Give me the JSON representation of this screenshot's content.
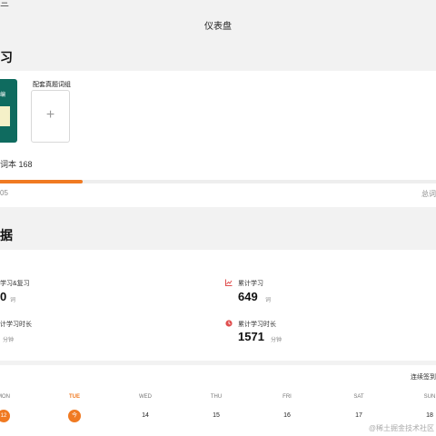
{
  "header": {
    "corner_text": "三",
    "title": "仪表盘"
  },
  "wordbook": {
    "section_title": "习",
    "current_book_text": "编",
    "add_label": "配套真题词组",
    "add_icon": "plus-icon",
    "count_text": "词本 168",
    "progress": 0.19,
    "progress_color": "#f07a22",
    "progress_left_text": "05",
    "progress_right_text": "总词"
  },
  "stats": {
    "section_title": "据",
    "items": [
      {
        "label": "学习&复习",
        "value": "0",
        "unit": "词",
        "icon": ""
      },
      {
        "label": "累计学习",
        "value": "649",
        "unit": "词",
        "icon": "chart-line-icon"
      },
      {
        "label": "计学习时长",
        "value": "",
        "unit": "分钟",
        "icon": ""
      },
      {
        "label": "累计学习时长",
        "value": "1571",
        "unit": "分钟",
        "icon": "clock-icon"
      }
    ]
  },
  "calendar": {
    "streak_text": "连续签到",
    "days": [
      {
        "weekday": "MON",
        "date": "12",
        "highlight": true,
        "today": false
      },
      {
        "weekday": "TUE",
        "date": "今",
        "highlight": true,
        "today": true
      },
      {
        "weekday": "WED",
        "date": "14",
        "highlight": false,
        "today": false
      },
      {
        "weekday": "THU",
        "date": "15",
        "highlight": false,
        "today": false
      },
      {
        "weekday": "FRI",
        "date": "16",
        "highlight": false,
        "today": false
      },
      {
        "weekday": "SAT",
        "date": "17",
        "highlight": false,
        "today": false
      },
      {
        "weekday": "SUN",
        "date": "18",
        "highlight": false,
        "today": false
      }
    ]
  },
  "watermark": "@稀土掘金技术社区",
  "colors": {
    "accent": "#f07a22",
    "book": "#0f6b5f",
    "stat_red": "#e05050"
  }
}
